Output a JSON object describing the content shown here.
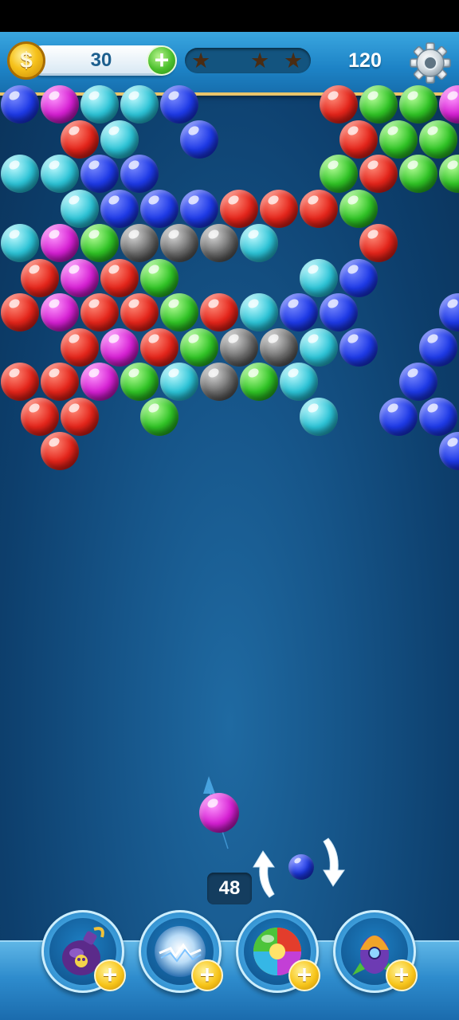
{
  "hud": {
    "coins": "30",
    "coin_symbol": "$",
    "add_symbol": "+",
    "stars_earned": 0,
    "stars_total": 3,
    "score": "120"
  },
  "shooter": {
    "current_color": "magenta",
    "next_color": "blue",
    "shots_left": "48"
  },
  "boosters": [
    {
      "name": "bomb-potion",
      "add_symbol": "+"
    },
    {
      "name": "lightning-orb",
      "add_symbol": "+"
    },
    {
      "name": "rainbow-ball",
      "add_symbol": "+"
    },
    {
      "name": "rocket-ship",
      "add_symbol": "+"
    }
  ],
  "colors": {
    "hud_blue": "#1d83c6",
    "gold_border": "#e9c46a",
    "background": "#165589"
  },
  "board": [
    "BMCCB...RGGMB.",
    ".RC.B...RGG...",
    "CCBB....GRGG..",
    ".CBBBRRRG.....",
    "CMGXXXC..R....",
    "RMRG...CB..BB.",
    "RMRRGRCBB..B..",
    ".RMRGXXCB.B...",
    "RRMGCXGC..B...",
    "RR.G...C.BB...",
    ".R.........B.."
  ]
}
